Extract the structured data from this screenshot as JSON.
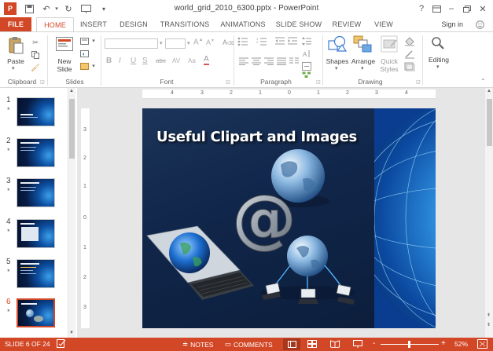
{
  "window": {
    "title": "world_grid_2010_6300.pptx - PowerPoint"
  },
  "tabs": [
    "FILE",
    "HOME",
    "INSERT",
    "DESIGN",
    "TRANSITIONS",
    "ANIMATIONS",
    "SLIDE SHOW",
    "REVIEW",
    "VIEW"
  ],
  "active_tab": "HOME",
  "account": {
    "signin_label": "Sign in"
  },
  "ribbon": {
    "clipboard": {
      "paste_label": "Paste",
      "group_label": "Clipboard"
    },
    "slides": {
      "new_slide_label": "New",
      "new_slide_label2": "Slide",
      "group_label": "Slides"
    },
    "font": {
      "group_label": "Font",
      "bold": "B",
      "italic": "I",
      "underline": "U",
      "strike": "S",
      "shadow": "abc",
      "spacing": "AV",
      "case": "Aa",
      "color": "A"
    },
    "paragraph": {
      "group_label": "Paragraph"
    },
    "drawing": {
      "shapes_label": "Shapes",
      "arrange_label": "Arrange",
      "quick_styles_label": "Quick",
      "quick_styles_label2": "Styles",
      "group_label": "Drawing"
    },
    "editing": {
      "label": "Editing"
    }
  },
  "thumbnails": [
    {
      "num": "1",
      "star": "*"
    },
    {
      "num": "2",
      "star": "*"
    },
    {
      "num": "3",
      "star": "*"
    },
    {
      "num": "4",
      "star": "*"
    },
    {
      "num": "5",
      "star": "*"
    },
    {
      "num": "6",
      "star": "*"
    }
  ],
  "selected_slide": 6,
  "ruler": {
    "h_ticks": [
      "4",
      "3",
      "2",
      "1",
      "0",
      "1",
      "2",
      "3",
      "4"
    ],
    "v_ticks": [
      "3",
      "2",
      "1",
      "0",
      "1",
      "2",
      "3"
    ]
  },
  "slide": {
    "title": "Useful Clipart and Images"
  },
  "status": {
    "slide_info": "SLIDE 6 OF 24",
    "notes_label": "NOTES",
    "comments_label": "COMMENTS",
    "zoom": "52%",
    "zoom_minus": "-",
    "zoom_plus": "+"
  },
  "colors": {
    "accent": "#d24726",
    "slide_bg": "#10264a",
    "globe_blue": "#2e8fe0"
  }
}
